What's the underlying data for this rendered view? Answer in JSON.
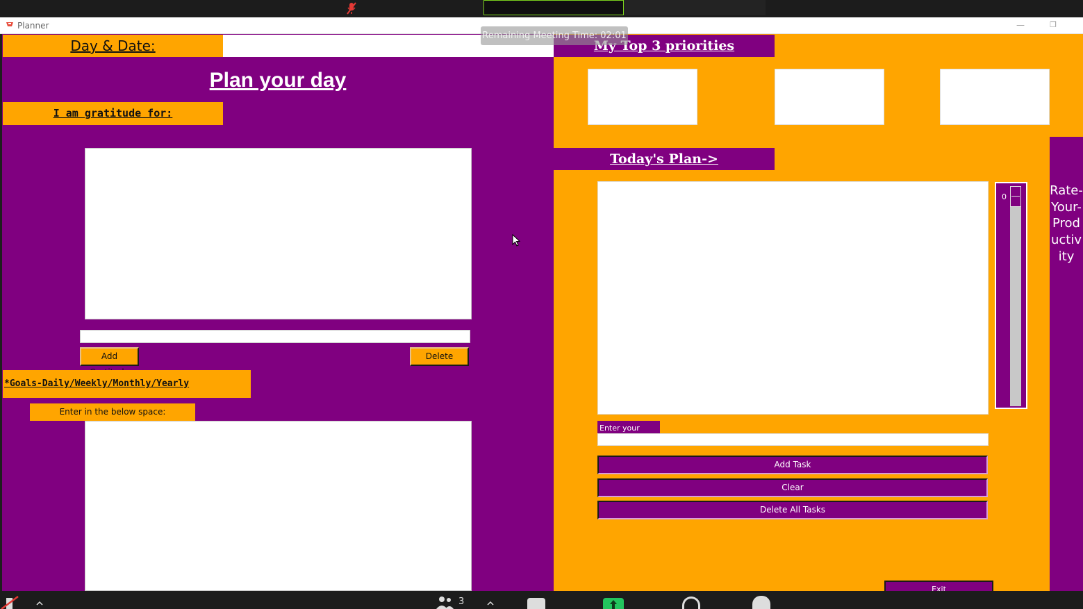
{
  "meeting": {
    "remaining_time": "Remaining Meeting Time: 02:01",
    "participants_count": "3"
  },
  "window": {
    "title": "Planner",
    "minimize_glyph": "—",
    "maximize_glyph": "❐"
  },
  "left": {
    "day_date_label": "Day & Date:",
    "day_date_value": "",
    "plan_title": "Plan your day",
    "gratitude_label": "I am gratitude for:",
    "gratitude_entry_value": "",
    "add_gratitude_label": "Add Gratitude",
    "delete_label": "Delete",
    "goals_label": "*Goals-Daily/Weekly/Monthly/Yearly",
    "enter_below_label": "Enter in the below space:"
  },
  "right": {
    "priorities_label": "My Top 3 priorities",
    "todays_plan_label": "Today's Plan->",
    "slider_value": "0",
    "rate_label": "Rate-Your-Productivity",
    "enter_task_label": "Enter your task:",
    "task_entry_value": "",
    "add_task_label": "Add Task",
    "clear_label": "Clear",
    "delete_all_label": "Delete All Tasks",
    "exit_label": "Exit"
  },
  "colors": {
    "purple": "#800080",
    "orange": "#ffa500",
    "meeting_bar": "#1c1c1c",
    "share_green": "#22c55e"
  },
  "icons": [
    "mic-muted-icon",
    "window-app-icon",
    "minimize-icon",
    "maximize-icon",
    "participants-icon",
    "chat-icon",
    "share-screen-icon",
    "record-icon",
    "reactions-icon",
    "caret-up-icon",
    "mouse-cursor-icon"
  ]
}
